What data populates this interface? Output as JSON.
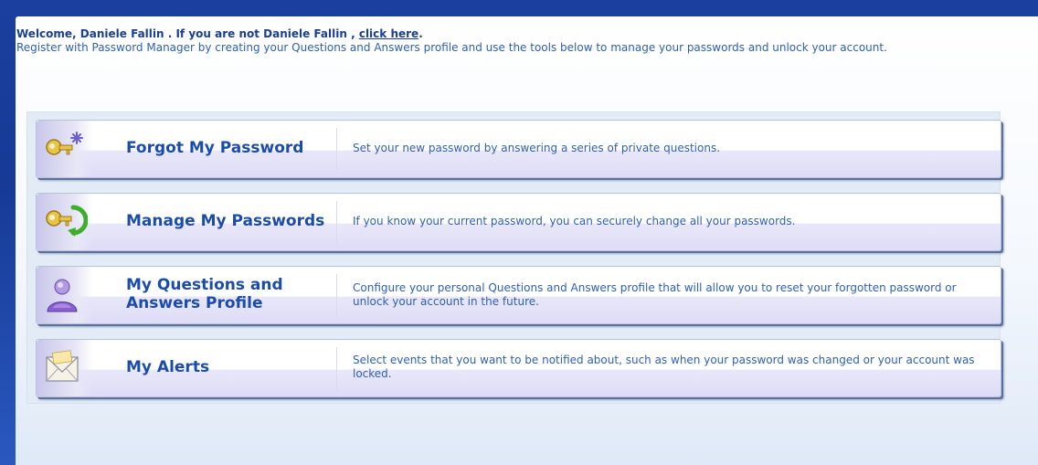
{
  "welcome": {
    "greeting_prefix": "Welcome, Daniele Fallin . If you are not Daniele Fallin , ",
    "click_here": "click here",
    "greeting_suffix": ".",
    "intro": "Register with Password Manager by creating your Questions and Answers profile and use the tools below to manage your passwords and unlock your account."
  },
  "tools": [
    {
      "icon": "key-sparkle-icon",
      "title": "Forgot My Password",
      "description": "Set your new password by answering a series of private questions."
    },
    {
      "icon": "key-arrow-icon",
      "title": "Manage My Passwords",
      "description": "If you know your current password, you can securely change all your passwords."
    },
    {
      "icon": "user-profile-icon",
      "title": "My Questions and Answers Profile",
      "description": "Configure your personal Questions and Answers profile that will allow you to reset your forgotten password or unlock your account in the future."
    },
    {
      "icon": "envelope-icon",
      "title": "My Alerts",
      "description": "Select events that you want to be notified about, such as when your password was changed or your account was locked."
    }
  ],
  "colors": {
    "background_blue": "#1a3f9e",
    "title_blue": "#1a4cae",
    "text_blue": "#2e5fb8"
  }
}
